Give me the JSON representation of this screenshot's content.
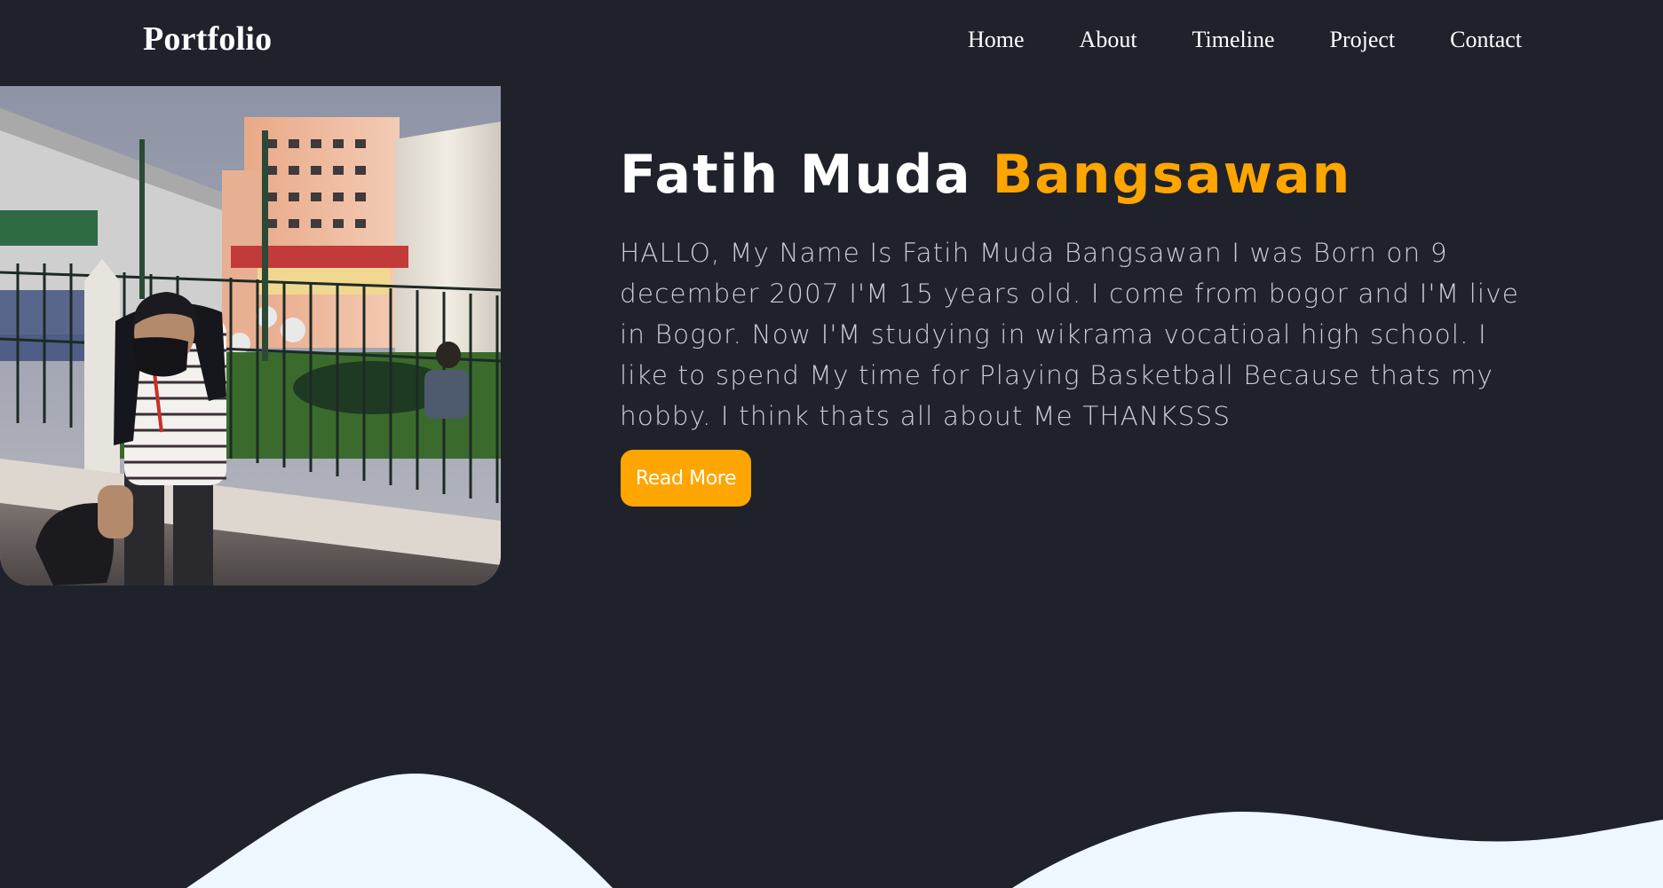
{
  "navbar": {
    "brand": "Portfolio",
    "links": [
      "Home",
      "About",
      "Timeline",
      "Project",
      "Contact"
    ]
  },
  "hero": {
    "name_first": "Fatih Muda ",
    "name_accent": "Bangsawan",
    "intro": "HALLO, My Name Is Fatih Muda Bangsawan I was Born on 9 december 2007 I'M 15 years old. I come from bogor and I'M live in Bogor. Now I'M studying in wikrama vocatioal high school. I like to spend My time for Playing Basketball Because thats my hobby. I think thats all about Me THANKSSS",
    "button_label": "Read More"
  },
  "colors": {
    "background": "#1f222b",
    "accent": "#ffa500",
    "wave": "#eef6ff",
    "text_muted": "#c9ccd6"
  }
}
